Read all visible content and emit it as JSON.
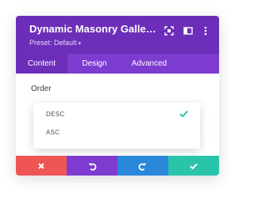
{
  "header": {
    "title": "Dynamic Masonry Gallery S...",
    "preset": "Preset: Default",
    "icons": [
      "expand-icon",
      "split-view-icon",
      "more-vertical-icon"
    ]
  },
  "tabs": [
    {
      "label": "Content",
      "active": true
    },
    {
      "label": "Design",
      "active": false
    },
    {
      "label": "Advanced",
      "active": false
    }
  ],
  "field": {
    "label": "Order",
    "options": [
      {
        "label": "DESC",
        "selected": true
      },
      {
        "label": "ASC",
        "selected": false
      }
    ]
  },
  "footer": {
    "buttons": [
      {
        "name": "discard",
        "icon": "close-icon",
        "color": "#ef5555"
      },
      {
        "name": "undo",
        "icon": "undo-icon",
        "color": "#7e3bd0"
      },
      {
        "name": "redo",
        "icon": "redo-icon",
        "color": "#2b87da"
      },
      {
        "name": "save",
        "icon": "check-icon",
        "color": "#29c4a9"
      }
    ]
  },
  "colors": {
    "header": "#6c2eb9",
    "tabs_bar": "#7d3bcf",
    "check": "#29c4a9"
  }
}
